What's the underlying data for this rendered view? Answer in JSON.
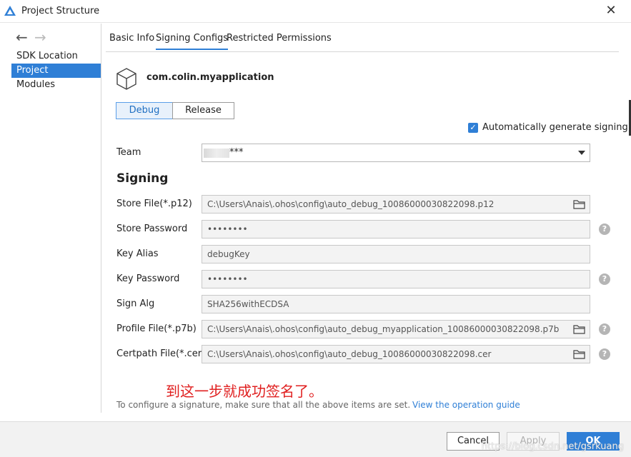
{
  "window": {
    "title": "Project Structure"
  },
  "sidebar": {
    "items": [
      {
        "label": "SDK Location"
      },
      {
        "label": "Project"
      },
      {
        "label": "Modules"
      }
    ]
  },
  "tabs": [
    {
      "label": "Basic Info"
    },
    {
      "label": "Signing Configs"
    },
    {
      "label": "Restricted Permissions"
    }
  ],
  "module": {
    "name": "com.colin.myapplication"
  },
  "build_types": {
    "debug": "Debug",
    "release": "Release"
  },
  "auto_sign": {
    "label": "Automatically generate signing",
    "checked": true
  },
  "team": {
    "label": "Team",
    "value": "***"
  },
  "signing": {
    "title": "Signing",
    "store_file": {
      "label": "Store File(*.p12)",
      "value": "C:\\Users\\Anais\\.ohos\\config\\auto_debug_10086000030822098.p12"
    },
    "store_password": {
      "label": "Store Password",
      "value": "••••••••"
    },
    "key_alias": {
      "label": "Key Alias",
      "value": "debugKey"
    },
    "key_password": {
      "label": "Key Password",
      "value": "••••••••"
    },
    "sign_alg": {
      "label": "Sign Alg",
      "value": "SHA256withECDSA"
    },
    "profile_file": {
      "label": "Profile File(*.p7b)",
      "value": "C:\\Users\\Anais\\.ohos\\config\\auto_debug_myapplication_10086000030822098.p7b"
    },
    "certpath_file": {
      "label": "Certpath File(*.cer)",
      "value": "C:\\Users\\Anais\\.ohos\\config\\auto_debug_10086000030822098.cer"
    }
  },
  "annotation": "到这一步就成功签名了。",
  "hint": "To configure a signature, make sure that all the above items are set.",
  "guide_link": "View the operation guide",
  "footer": {
    "cancel": "Cancel",
    "apply": "Apply",
    "ok": "OK"
  },
  "watermark": "https://blog.csdn.net/gsrkuang",
  "icons": {
    "help": "?",
    "close": "✕",
    "check": "✓"
  }
}
